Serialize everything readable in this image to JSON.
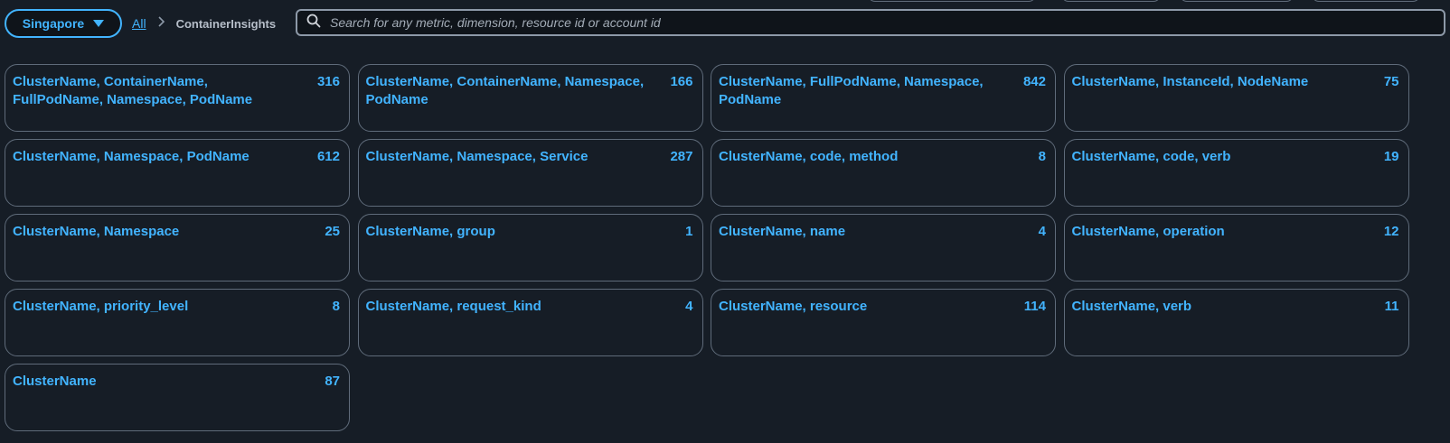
{
  "region": {
    "label": "Singapore"
  },
  "breadcrumb": {
    "root": "All",
    "current": "ContainerInsights"
  },
  "search": {
    "placeholder": "Search for any metric, dimension, resource id or account id",
    "value": ""
  },
  "cards": [
    {
      "title": "ClusterName, ContainerName, FullPodName, Namespace, PodName",
      "count": "316"
    },
    {
      "title": "ClusterName, ContainerName, Namespace, PodName",
      "count": "166"
    },
    {
      "title": "ClusterName, FullPodName, Namespace, PodName",
      "count": "842"
    },
    {
      "title": "ClusterName, InstanceId, NodeName",
      "count": "75"
    },
    {
      "title": "ClusterName, Namespace, PodName",
      "count": "612"
    },
    {
      "title": "ClusterName, Namespace, Service",
      "count": "287"
    },
    {
      "title": "ClusterName, code, method",
      "count": "8"
    },
    {
      "title": "ClusterName, code, verb",
      "count": "19"
    },
    {
      "title": "ClusterName, Namespace",
      "count": "25"
    },
    {
      "title": "ClusterName, group",
      "count": "1"
    },
    {
      "title": "ClusterName, name",
      "count": "4"
    },
    {
      "title": "ClusterName, operation",
      "count": "12"
    },
    {
      "title": "ClusterName, priority_level",
      "count": "8"
    },
    {
      "title": "ClusterName, request_kind",
      "count": "4"
    },
    {
      "title": "ClusterName, resource",
      "count": "114"
    },
    {
      "title": "ClusterName, verb",
      "count": "11"
    },
    {
      "title": "ClusterName",
      "count": "87"
    }
  ],
  "icons": {
    "region_caret": "caret-down-icon",
    "breadcrumb_separator": "chevron-right-icon",
    "search": "search-icon"
  },
  "colors": {
    "accent": "#42b4ff",
    "background": "#161d26",
    "card_border": "#5f6b7a"
  }
}
